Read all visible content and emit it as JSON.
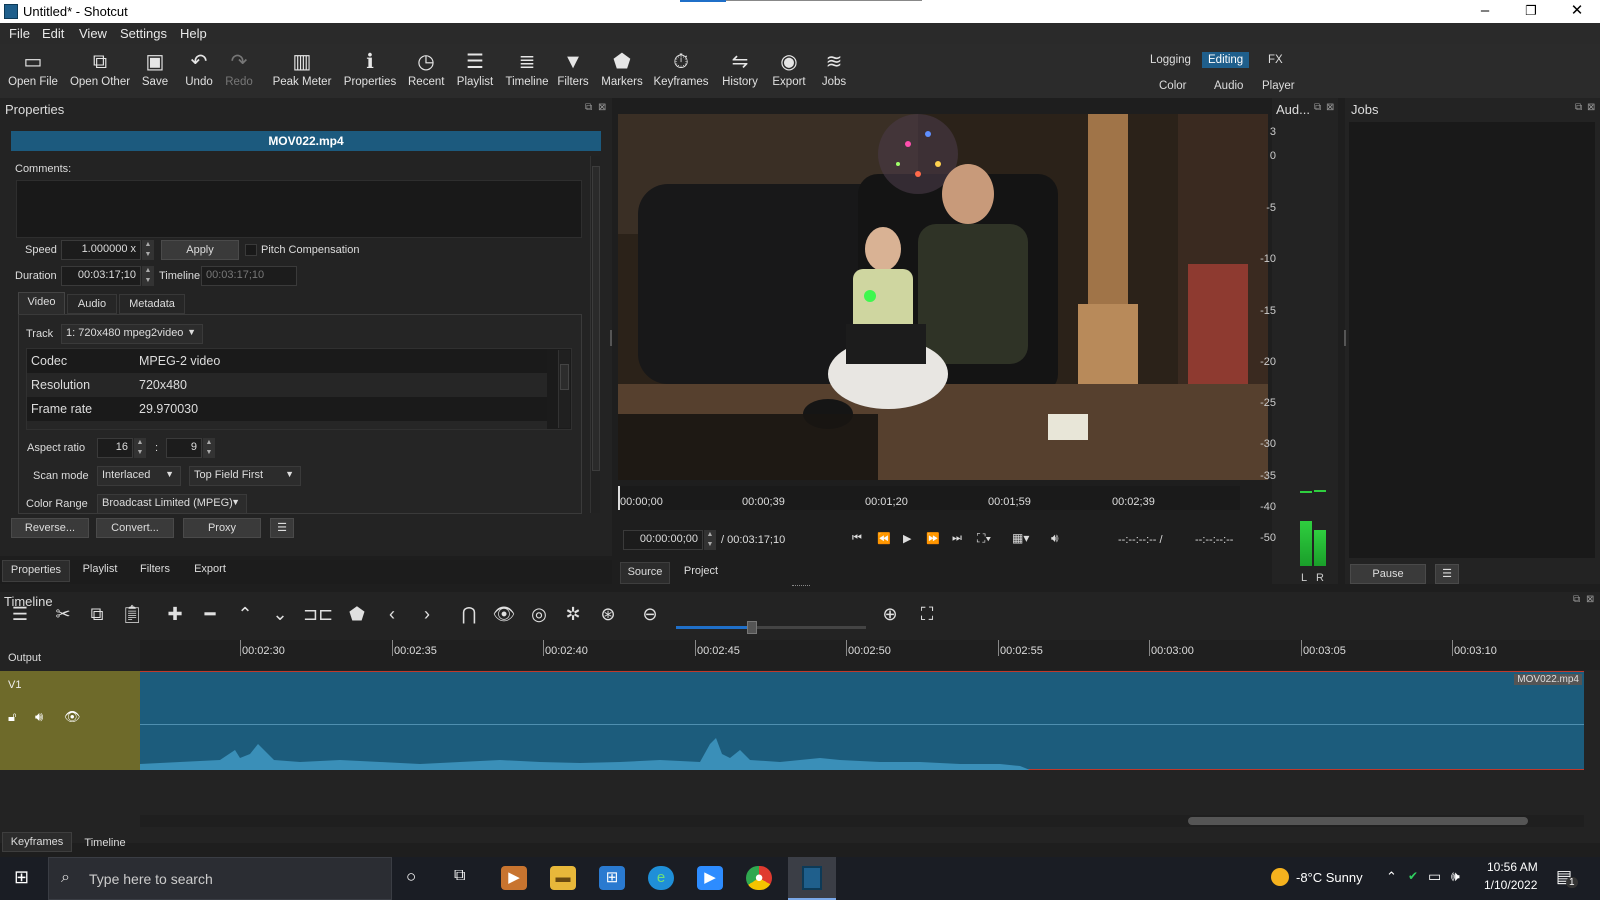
{
  "window": {
    "title": "Untitled* - Shotcut"
  },
  "menu": [
    "File",
    "Edit",
    "View",
    "Settings",
    "Help"
  ],
  "toolbar": [
    {
      "label": "Open File",
      "icon": "open-file-icon"
    },
    {
      "label": "Open Other",
      "icon": "open-other-icon"
    },
    {
      "label": "Save",
      "icon": "save-icon"
    },
    {
      "label": "Undo",
      "icon": "undo-icon"
    },
    {
      "label": "Redo",
      "icon": "redo-icon",
      "disabled": true
    },
    {
      "label": "Peak Meter",
      "icon": "peak-meter-icon"
    },
    {
      "label": "Properties",
      "icon": "properties-icon"
    },
    {
      "label": "Recent",
      "icon": "recent-icon"
    },
    {
      "label": "Playlist",
      "icon": "playlist-icon"
    },
    {
      "label": "Timeline",
      "icon": "timeline-icon"
    },
    {
      "label": "Filters",
      "icon": "filters-icon"
    },
    {
      "label": "Markers",
      "icon": "markers-icon"
    },
    {
      "label": "Keyframes",
      "icon": "keyframes-icon"
    },
    {
      "label": "History",
      "icon": "history-icon"
    },
    {
      "label": "Export",
      "icon": "export-icon"
    },
    {
      "label": "Jobs",
      "icon": "jobs-icon"
    }
  ],
  "layouts": {
    "logging": "Logging",
    "editing": "Editing",
    "fx": "FX",
    "color": "Color",
    "audio": "Audio",
    "player": "Player",
    "active": "Editing"
  },
  "properties": {
    "panel_title": "Properties",
    "file_name": "MOV022.mp4",
    "comments_label": "Comments:",
    "comments_value": "",
    "speed_label": "Speed",
    "speed_value": "1.000000 x",
    "apply_label": "Apply",
    "pitch_label": "Pitch Compensation",
    "pitch_checked": false,
    "duration_label": "Duration",
    "duration_value": "00:03:17;10",
    "timeline_label": "Timeline",
    "timeline_value": "00:03:17;10",
    "tabs": [
      "Video",
      "Audio",
      "Metadata"
    ],
    "active_tab": "Video",
    "track_label": "Track",
    "track_value": "1: 720x480 mpeg2video",
    "info_rows": [
      {
        "key": "Codec",
        "value": "MPEG-2 video"
      },
      {
        "key": "Resolution",
        "value": "720x480"
      },
      {
        "key": "Frame rate",
        "value": "29.970030"
      }
    ],
    "aspect_label": "Aspect ratio",
    "aspect_w": "16",
    "aspect_h": "9",
    "scan_label": "Scan mode",
    "scan_value": "Interlaced",
    "field_order": "Top Field First",
    "color_range_label": "Color Range",
    "color_range_value": "Broadcast Limited (MPEG)",
    "buttons": [
      "Reverse...",
      "Convert...",
      "Proxy"
    ]
  },
  "left_tabs": [
    "Properties",
    "Playlist",
    "Filters",
    "Export"
  ],
  "player": {
    "ruler_labels": [
      "00:00;00",
      "00:00;39",
      "00:01;20",
      "00:01;59",
      "00:02;39"
    ],
    "position": "00:00:00;00",
    "duration": "/ 00:03:17;10",
    "in_point": "--:--:--:-- /",
    "out_point": "--:--:--:--",
    "tabs": [
      "Source",
      "Project"
    ],
    "active_tab": "Source"
  },
  "audio_meter": {
    "title": "Aud...",
    "scale": [
      "3",
      "0",
      "-5",
      "-10",
      "-15",
      "-20",
      "-25",
      "-30",
      "-35",
      "-40",
      "-50"
    ],
    "channels": [
      "L",
      "R"
    ],
    "levels_db": [
      -40,
      -42
    ]
  },
  "jobs": {
    "title": "Jobs",
    "pause_label": "Pause"
  },
  "timeline": {
    "title": "Timeline",
    "output_label": "Output",
    "track_name": "V1",
    "clip_name": "MOV022.mp4",
    "ruler_labels": [
      "00:02:30",
      "00:02:35",
      "00:02:40",
      "00:02:45",
      "00:02:50",
      "00:02:55",
      "00:03:00",
      "00:03:05",
      "00:03:10"
    ],
    "zoom_level": 0.4,
    "tools": [
      "menu-icon",
      "cut-icon",
      "copy-icon",
      "paste-icon",
      "append-icon",
      "remove-icon",
      "lift-icon",
      "overwrite-icon",
      "split-icon",
      "marker-icon",
      "prev-marker-icon",
      "next-marker-icon",
      "snap-icon",
      "scrub-icon",
      "ripple-icon",
      "ripple-all-icon",
      "ripple-markers-icon",
      "zoom-out-icon",
      "zoom-in-icon",
      "zoom-fit-icon"
    ]
  },
  "bottom_tabs": [
    "Keyframes",
    "Timeline"
  ],
  "taskbar": {
    "search_placeholder": "Type here to search",
    "weather": "-8°C  Sunny",
    "time": "10:56 AM",
    "date": "1/10/2022",
    "notification_count": "1"
  }
}
